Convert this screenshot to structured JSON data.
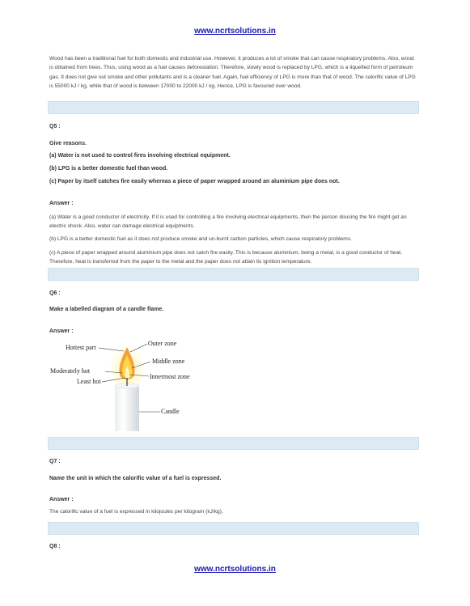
{
  "header": {
    "site": "www.ncrtsolutions.in"
  },
  "footer": {
    "site": "www.ncrtsolutions.in"
  },
  "intro": {
    "paragraph": "Wood has been a traditional fuel for both domestic and industrial use. However, it produces a lot of smoke that can cause respiratory problems. Also, wood is obtained from trees. Thus, using wood as a fuel causes deforestation. Therefore, slowly wood is replaced by LPG, which is a liquefied form of petroleum gas. It does not give out smoke and other pollutants and is a cleaner fuel. Again, fuel efficiency of LPG is more than that of wood. The calorific value of LPG is 55000 kJ / kg, while that of wood is between 17000 to 22000 kJ / kg. Hence, LPG is favoured over wood."
  },
  "q5": {
    "label": "Q5 :",
    "prompt": "Give reasons.",
    "items": [
      "(a) Water is not used to control fires involving electrical equipment.",
      "(b) LPG is a better domestic fuel than wood.",
      "(c) Paper by itself catches fire easily whereas a piece of paper wrapped around an aluminium pipe does not."
    ],
    "answer_label": "Answer :",
    "answers": [
      "(a) Water is a good conductor of electricity. If it is used for controlling a fire involving electrical equipments, then the person dousing the fire might get an electric shock. Also, water can damage electrical equipments.",
      "(b) LPG is a better domestic fuel as it does not produce smoke and un-burnt carbon particles, which cause respiratory problems.",
      "(c) A piece of paper wrapped around aluminium pipe does not catch fire easily. This is because aluminium, being a metal, is a good conductor of heat. Therefore, heat is transferred from the paper to the metal and the paper does not attain its ignition temperature."
    ]
  },
  "q6": {
    "label": "Q6 :",
    "question": "Make a labelled diagram of a candle flame.",
    "answer_label": "Answer :",
    "diagram": {
      "hottest": "Hottest part",
      "moderately": "Moderately hot",
      "least": "Least hot",
      "outer": "Outer zone",
      "middle": "Middle zone",
      "innermost": "Innermost zone",
      "candle": "Candle"
    }
  },
  "q7": {
    "label": "Q7 :",
    "question": "Name the unit in which the calorific value of a fuel is expressed.",
    "answer_label": "Answer :",
    "answer": "The calorific value of a fuel is expressed in kilojoules per kilogram (kJ/kg)."
  },
  "q8": {
    "label": "Q8 :"
  }
}
